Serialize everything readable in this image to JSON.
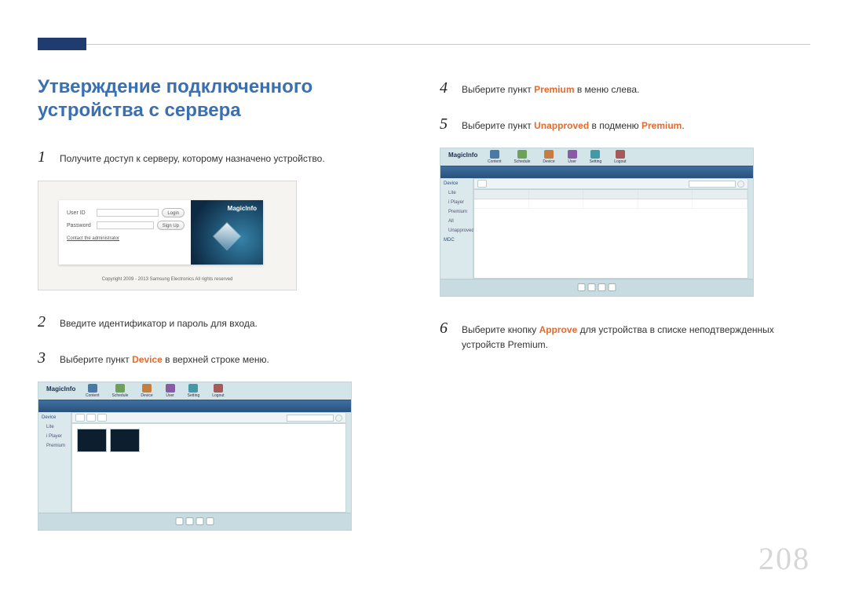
{
  "page_number": "208",
  "title": "Утверждение подключенного устройства с сервера",
  "highlight_words": {
    "device": "Device",
    "premium": "Premium",
    "unapproved": "Unapproved",
    "approve": "Approve"
  },
  "steps": {
    "1": {
      "num": "1",
      "text": "Получите доступ к серверу, которому назначено устройство."
    },
    "2": {
      "num": "2",
      "text": "Введите идентификатор и пароль для входа."
    },
    "3": {
      "num": "3",
      "before": "Выберите пункт ",
      "after": " в верхней строке меню."
    },
    "4": {
      "num": "4",
      "before": "Выберите пункт ",
      "after": " в меню слева."
    },
    "5": {
      "num": "5",
      "before": "Выберите пункт ",
      "mid": " в подменю ",
      "after": "."
    },
    "6": {
      "num": "6",
      "before": "Выберите кнопку ",
      "after": " для устройства в списке неподтвержденных устройств Premium."
    }
  },
  "login_shot": {
    "user_id_label": "User ID",
    "password_label": "Password",
    "login_btn": "Login",
    "signup_btn": "Sign Up",
    "contact": "Contact the administrator",
    "brand": "MagicInfo",
    "copyright": "Copyright 2009 - 2013 Samsung Electronics All rights reserved"
  },
  "app_shot": {
    "brand": "MagicInfo",
    "top_tabs": [
      "Content",
      "Schedule",
      "Device",
      "User",
      "Setting",
      "Logout"
    ],
    "side_items": [
      "Device",
      "Lite",
      "i Player",
      "Premium",
      "All",
      "Unapproved",
      "MDC"
    ]
  }
}
